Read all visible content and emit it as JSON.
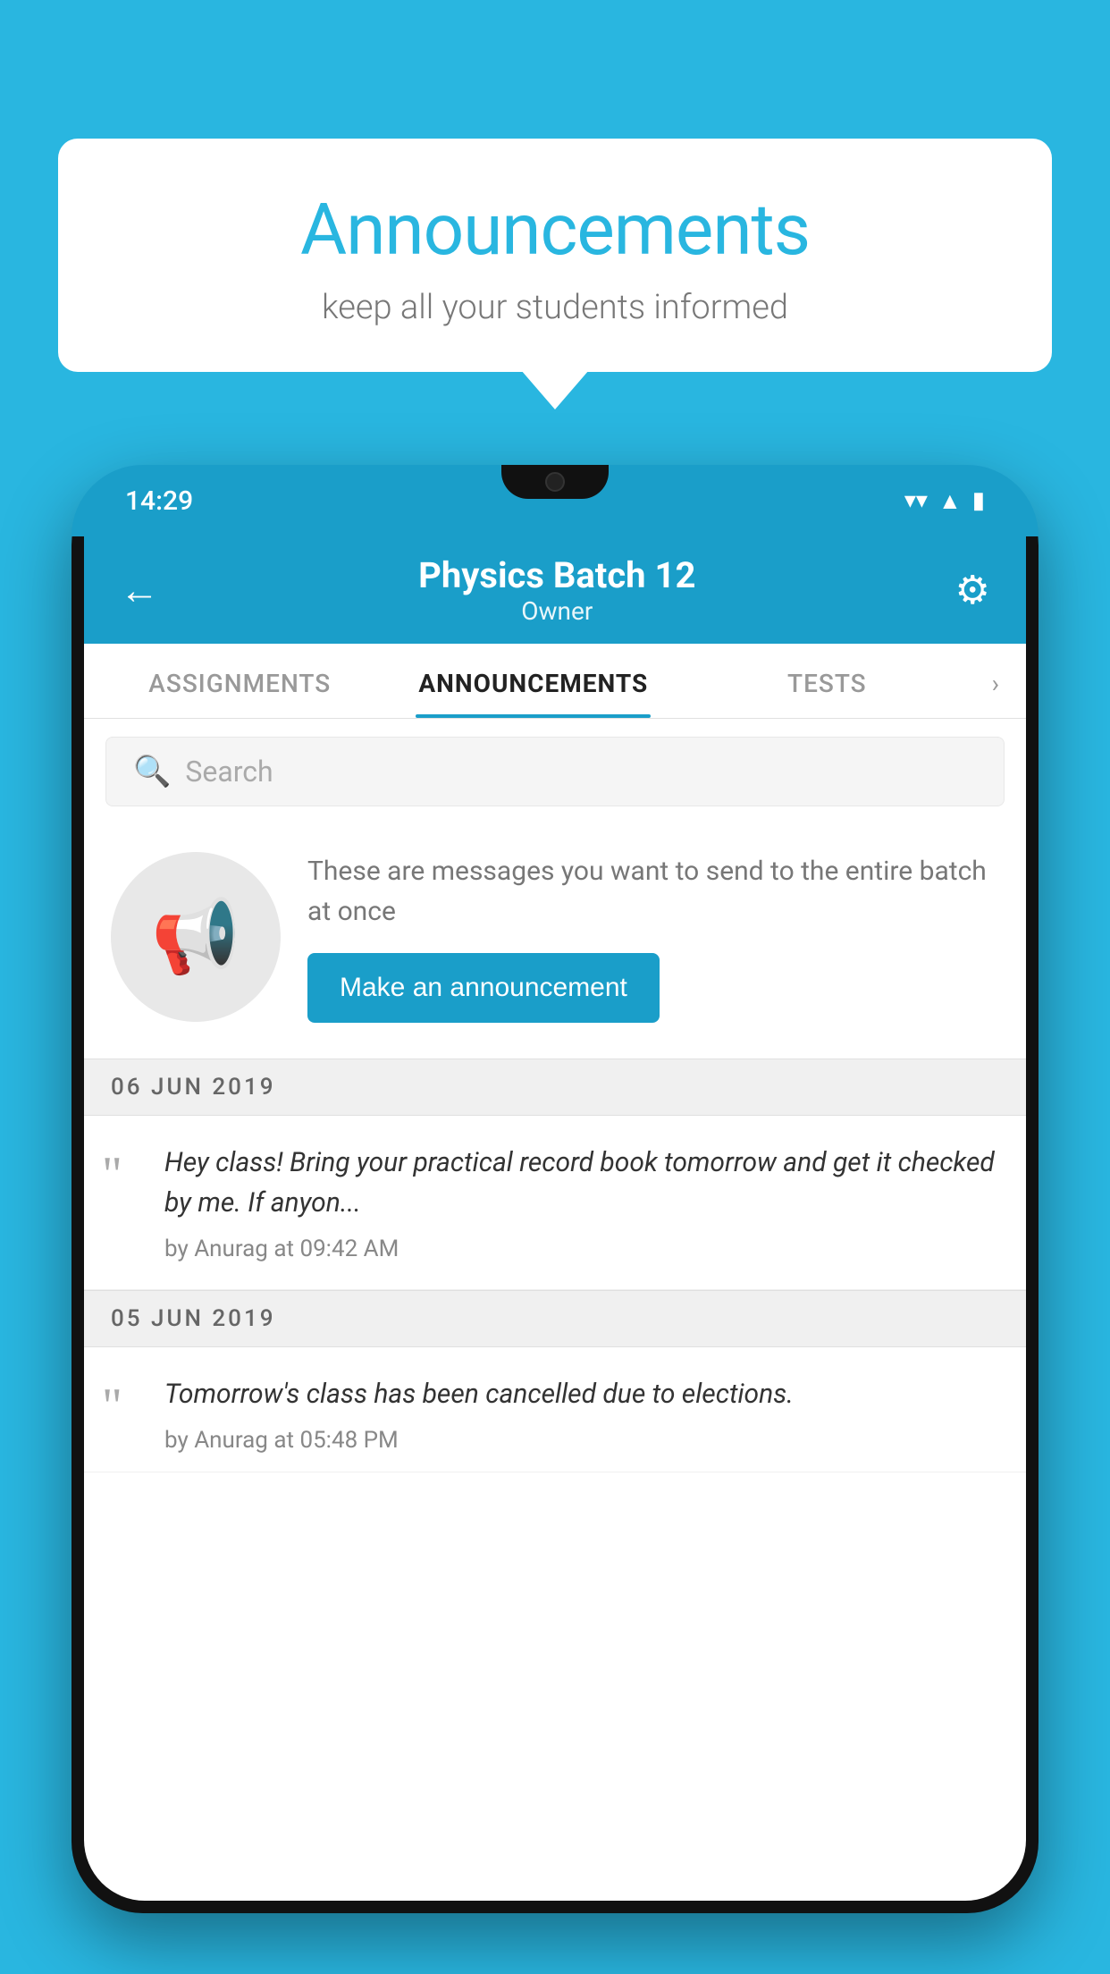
{
  "background": {
    "color": "#29b6e0"
  },
  "speech_bubble": {
    "title": "Announcements",
    "subtitle": "keep all your students informed"
  },
  "phone": {
    "status_bar": {
      "time": "14:29",
      "icons": [
        "wifi",
        "signal",
        "battery"
      ]
    },
    "header": {
      "back_label": "←",
      "title": "Physics Batch 12",
      "subtitle": "Owner",
      "settings_icon": "⚙"
    },
    "tabs": [
      {
        "label": "ASSIGNMENTS",
        "active": false
      },
      {
        "label": "ANNOUNCEMENTS",
        "active": true
      },
      {
        "label": "TESTS",
        "active": false
      }
    ],
    "search": {
      "placeholder": "Search"
    },
    "promo": {
      "icon": "📢",
      "text": "These are messages you want to send to the entire batch at once",
      "button_label": "Make an announcement"
    },
    "announcements": [
      {
        "date": "06  JUN  2019",
        "text": "Hey class! Bring your practical record book tomorrow and get it checked by me. If anyon...",
        "by": "by Anurag at 09:42 AM"
      },
      {
        "date": "05  JUN  2019",
        "text": "Tomorrow's class has been cancelled due to elections.",
        "by": "by Anurag at 05:48 PM"
      }
    ]
  }
}
